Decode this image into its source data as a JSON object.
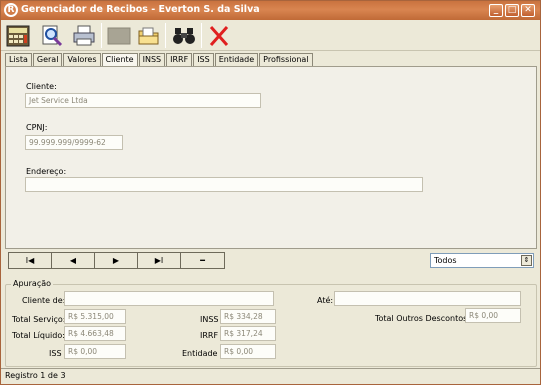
{
  "window": {
    "title": "Gerenciador de Recibos - Everton S. da Silva",
    "minimize": "_",
    "maximize": "□",
    "close": "✕"
  },
  "toolbar": {
    "icons": [
      "calculator-icon",
      "search-doc-icon",
      "print-icon",
      "blank-icon",
      "folder-icon",
      "binoculars-icon",
      "close-red-icon"
    ]
  },
  "tabs": [
    {
      "label": "Lista"
    },
    {
      "label": "Geral"
    },
    {
      "label": "Valores"
    },
    {
      "label": "Cliente"
    },
    {
      "label": "INSS"
    },
    {
      "label": "IRRF"
    },
    {
      "label": "ISS"
    },
    {
      "label": "Entidade"
    },
    {
      "label": "Profissional"
    }
  ],
  "active_tab": "Cliente",
  "cliente": {
    "cliente_label": "Cliente:",
    "cliente_value": "Jet Service Ltda",
    "cpnj_label": "CPNJ:",
    "cpnj_value": "99.999.999/9999-62",
    "endereco_label": "Endereço:",
    "endereco_value": ""
  },
  "nav": {
    "first": "I◀",
    "prev": "◀",
    "next": "▶",
    "last": "▶I",
    "delete": "━"
  },
  "filter": {
    "selected": "Todos"
  },
  "apuracao": {
    "title": "Apuração",
    "cliente_de_label": "Cliente de:",
    "cliente_de_value": "",
    "ate_label": "Até:",
    "ate_value": "",
    "total_servico_label": "Total Serviço:",
    "total_servico_value": "R$ 5.315,00",
    "total_liquido_label": "Total Líquido:",
    "total_liquido_value": "R$ 4.663,48",
    "iss_label": "ISS",
    "iss_value": "R$ 0,00",
    "inss_label": "INSS",
    "inss_value": "R$ 334,28",
    "irrf_label": "IRRF",
    "irrf_value": "R$ 317,24",
    "entidade_label": "Entidade",
    "entidade_value": "R$ 0,00",
    "outros_label": "Total Outros Descontos:",
    "outros_value": "R$ 0,00"
  },
  "status": {
    "text": "Registro 1 de 3"
  }
}
